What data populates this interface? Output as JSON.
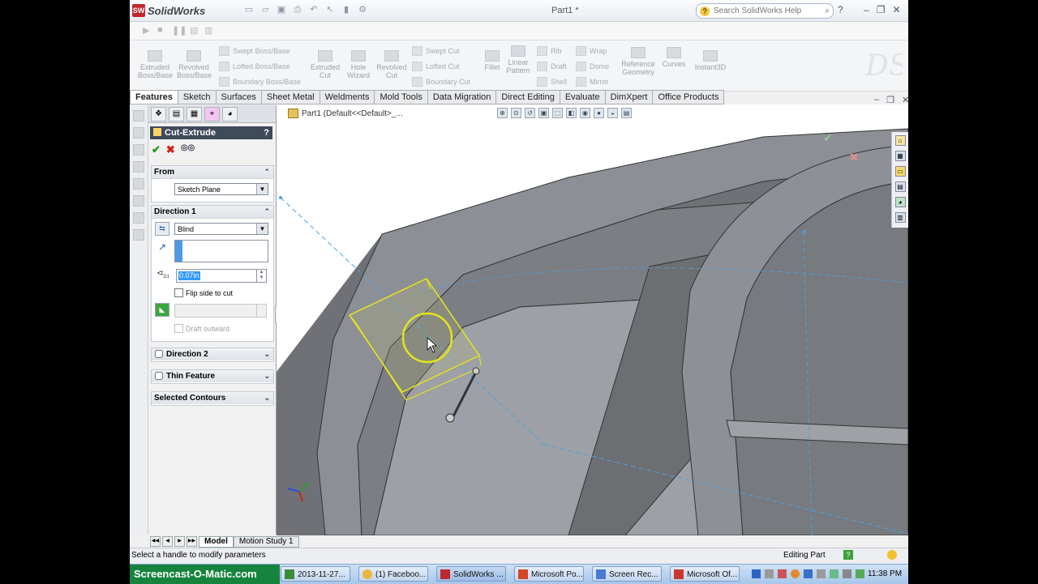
{
  "app": {
    "name": "SolidWorks",
    "document_title": "Part1 *",
    "help_search_placeholder": "Search SolidWorks Help",
    "help_menu": "?"
  },
  "ribbon": {
    "large_buttons": [
      {
        "label1": "Extruded",
        "label2": "Boss/Base"
      },
      {
        "label1": "Revolved",
        "label2": "Boss/Base"
      },
      {
        "label1": "Extruded",
        "label2": "Cut"
      },
      {
        "label1": "Hole",
        "label2": "Wizard"
      },
      {
        "label1": "Revolved",
        "label2": "Cut"
      },
      {
        "label1": "Fillet",
        "label2": ""
      },
      {
        "label1": "Linear",
        "label2": "Pattern"
      },
      {
        "label1": "Reference",
        "label2": "Geometry"
      },
      {
        "label1": "Curves",
        "label2": ""
      },
      {
        "label1": "Instant3D",
        "label2": ""
      }
    ],
    "small_buttons": [
      "Swept Boss/Base",
      "Lofted Boss/Base",
      "Boundary Boss/Base",
      "Swept Cut",
      "Lofted Cut",
      "Boundary Cut",
      "Rib",
      "Draft",
      "Shell",
      "Wrap",
      "Dome",
      "Mirror"
    ]
  },
  "tabs": [
    "Features",
    "Sketch",
    "Surfaces",
    "Sheet Metal",
    "Weldments",
    "Mold Tools",
    "Data Migration",
    "Direct Editing",
    "Evaluate",
    "DimXpert",
    "Office Products"
  ],
  "property_manager": {
    "title": "Cut-Extrude",
    "help": "?",
    "from": {
      "header": "From",
      "value": "Sketch Plane"
    },
    "direction1": {
      "header": "Direction 1",
      "end_condition": "Blind",
      "depth": "0.07in",
      "depth_label": "D1",
      "flip_side": "Flip side to cut",
      "draft_outward": "Draft outward"
    },
    "direction2": {
      "header": "Direction 2"
    },
    "thin_feature": {
      "header": "Thin Feature"
    },
    "selected_contours": {
      "header": "Selected Contours"
    }
  },
  "viewport": {
    "breadcrumb": "Part1  (Default<<Default>_..."
  },
  "model_tabs": [
    "Model",
    "Motion Study 1"
  ],
  "status": {
    "message": "Select a handle to modify parameters",
    "mode": "Editing Part"
  },
  "taskbar": {
    "start": "Screencast-O-Matic.com",
    "items": [
      "2013-11-27...",
      "(1) Faceboo...",
      "SolidWorks ...",
      "Microsoft Po...",
      "Screen Rec...",
      "Microsoft Of..."
    ],
    "clock": "11:38 PM"
  },
  "colors": {
    "accent": "#3f4a5a",
    "preview": "#e5e51a",
    "body_dark": "#6f7176",
    "body_light": "#9da0a6"
  }
}
